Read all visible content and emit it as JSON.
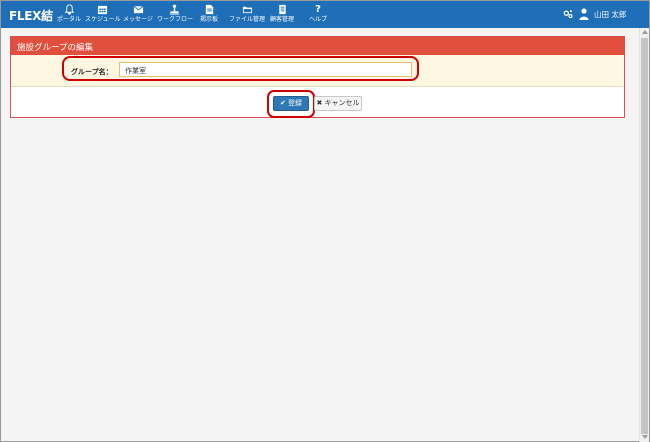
{
  "header": {
    "brand": "FLEX結",
    "nav": [
      {
        "label": "ポータル",
        "icon": "bell-icon"
      },
      {
        "label": "スケジュール",
        "icon": "calendar-icon"
      },
      {
        "label": "メッセージ",
        "icon": "envelope-icon"
      },
      {
        "label": "ワークフロー",
        "icon": "workflow-icon"
      },
      {
        "label": "掲示板",
        "icon": "bulletin-icon"
      },
      {
        "label": "ファイル管理",
        "icon": "folder-icon"
      },
      {
        "label": "顧客管理",
        "icon": "customer-icon"
      },
      {
        "label": "ヘルプ",
        "icon": "help-icon"
      }
    ],
    "user_name": "山田 太郎"
  },
  "panel": {
    "title": "施設グループの編集",
    "field_label": "グループ名：",
    "field_value": "作業室"
  },
  "actions": {
    "save_label": "登録",
    "cancel_label": "キャンセル"
  },
  "colors": {
    "navbar": "#1f6fb8",
    "panel_heading": "#e04f3c",
    "highlight": "#d00000",
    "primary_button": "#2f78b5"
  }
}
